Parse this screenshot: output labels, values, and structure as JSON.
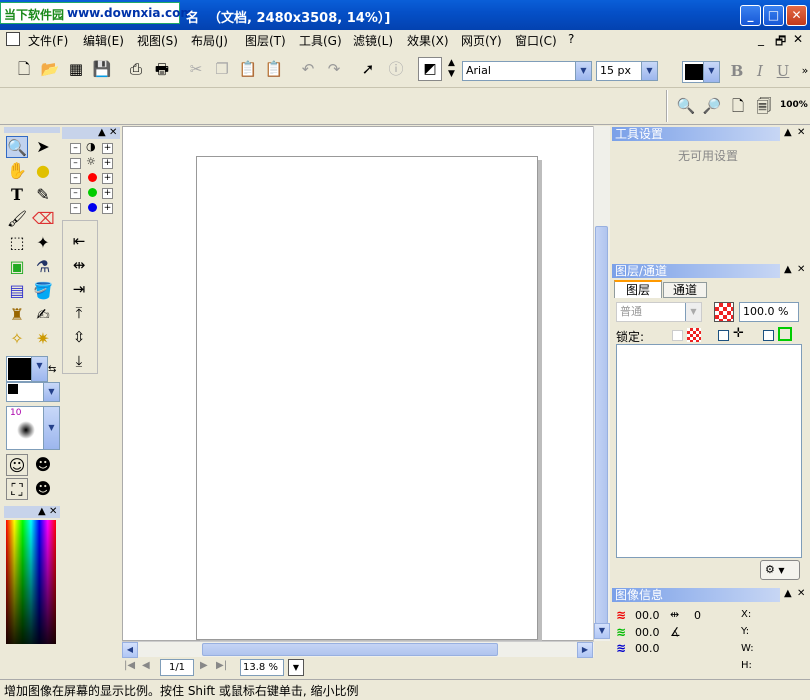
{
  "window": {
    "title": "名  （文档, 2480x3508, 14%）]",
    "min": "_",
    "max": "□",
    "close": "✕"
  },
  "logo": {
    "cn": "当下软件园",
    "url": "www.downxia.com"
  },
  "menu": [
    "文件(F)",
    "编辑(E)",
    "视图(S)",
    "布局(J)",
    "图层(T)",
    "工具(G)",
    "滤镜(L)",
    "效果(X)",
    "网页(Y)",
    "窗口(C)",
    "?"
  ],
  "mdi": {
    "min": "_",
    "restore": "🗗",
    "close": "✕"
  },
  "toolbar": {
    "font": "Arial",
    "size": "15 px",
    "color": "#000000",
    "bold": "B",
    "italic": "I",
    "underline": "U",
    "zoom_label": "100%"
  },
  "color_swatches": [
    "#000000",
    "#ffffff",
    "#ff0000",
    "#00cc00",
    "#0000ee"
  ],
  "brush": {
    "size": "10"
  },
  "tool_settings": {
    "title": "工具设置",
    "empty": "无可用设置"
  },
  "layers": {
    "title": "图层/通道",
    "tabs": [
      "图层",
      "通道"
    ],
    "blend": "普通",
    "opacity": "100.0 %",
    "lock_label": "锁定:"
  },
  "image_info": {
    "title": "图像信息",
    "red": "00.0",
    "green": "00.0",
    "blue": "00.0",
    "width_val": "0",
    "x": "X:",
    "y": "Y:",
    "w": "W:",
    "h": "H:"
  },
  "nav": {
    "page": "1/1",
    "zoom": "13.8 %"
  },
  "status": "增加图像在屏幕的显示比例。按住 Shift 或鼠标右键单击, 缩小比例"
}
